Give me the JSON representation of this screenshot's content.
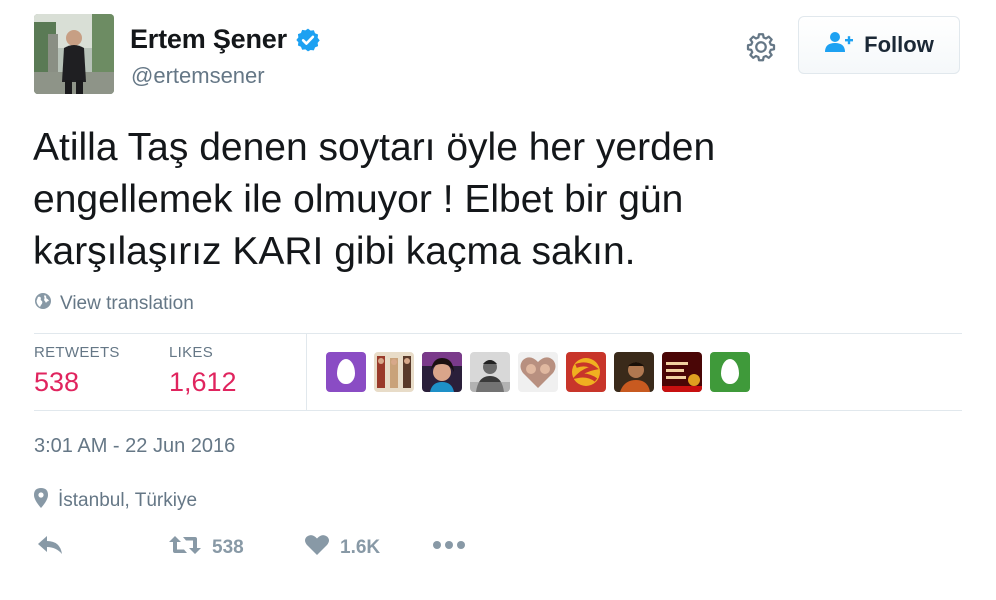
{
  "user": {
    "display_name": "Ertem Şener",
    "handle": "@ertemsener",
    "verified_icon": "verified-badge-icon"
  },
  "header": {
    "follow_label": "Follow"
  },
  "tweet": {
    "text": "Atilla Taş denen soytarı öyle her yerden\nengellemek ile olmuyor ! Elbet bir gün\nkarşılaşırız KARI gibi kaçma sakın.",
    "view_translation": "View translation"
  },
  "stats": {
    "retweets_label": "RETWEETS",
    "retweets_value": "538",
    "likes_label": "LIKES",
    "likes_value": "1,612"
  },
  "liked_by_avatars": [
    {
      "kind": "egg",
      "color": "#8a4cc4"
    },
    {
      "kind": "photo",
      "color": "#a67a5a"
    },
    {
      "kind": "photo",
      "color": "#2a1f3a"
    },
    {
      "kind": "photo",
      "color": "#8a8a8a"
    },
    {
      "kind": "photo",
      "color": "#b09080"
    },
    {
      "kind": "photo",
      "color": "#c8352a"
    },
    {
      "kind": "photo",
      "color": "#3a2a1a"
    },
    {
      "kind": "photo",
      "color": "#8a1010"
    },
    {
      "kind": "egg",
      "color": "#3f9a3a"
    }
  ],
  "meta": {
    "timestamp": "3:01 AM - 22 Jun 2016",
    "location": "İstanbul, Türkiye"
  },
  "actions": {
    "retweet_count": "538",
    "like_count": "1.6K"
  },
  "colors": {
    "accent_red": "#e0245e",
    "muted": "#657786",
    "action_gray": "#8899a6",
    "verified_blue": "#1da1f2"
  }
}
